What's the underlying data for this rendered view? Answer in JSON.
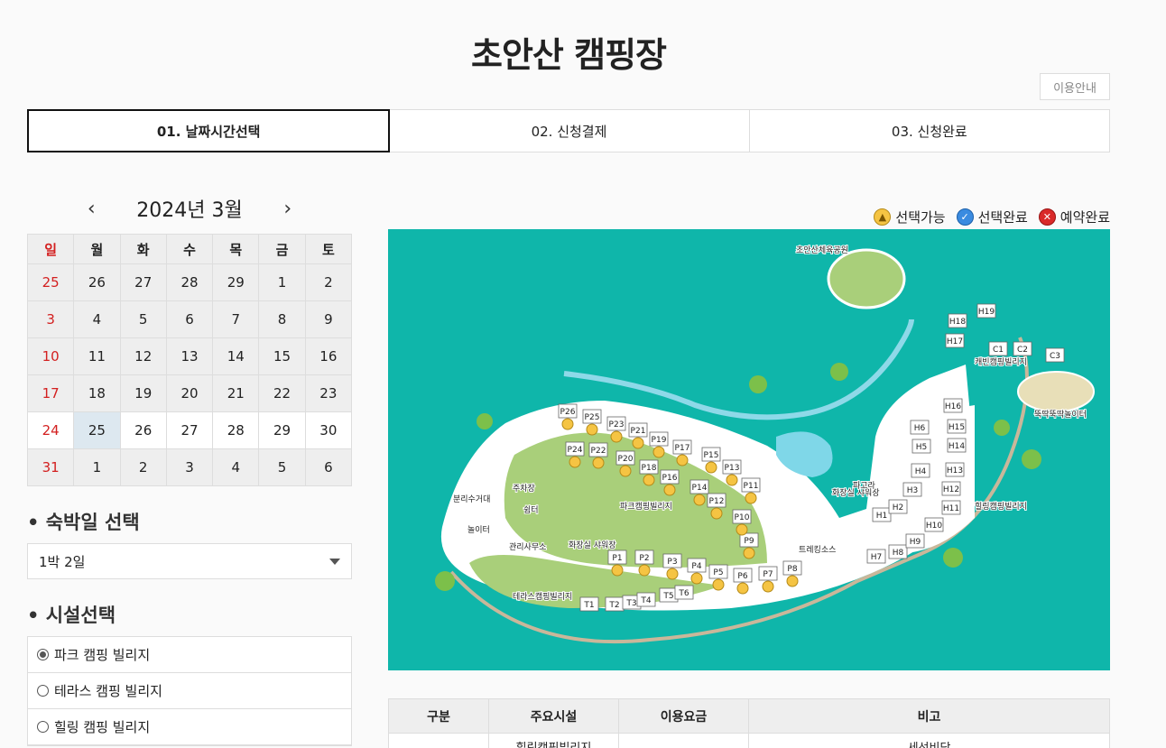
{
  "page": {
    "title": "초안산 캠핑장",
    "guide_button": "이용안내"
  },
  "steps": [
    {
      "label": "01. 날짜시간선택",
      "active": true
    },
    {
      "label": "02. 신청결제",
      "active": false
    },
    {
      "label": "03. 신청완료",
      "active": false
    }
  ],
  "calendar": {
    "month_label": "2024년 3월",
    "prev_icon": "chevron-left-icon",
    "next_icon": "chevron-right-icon",
    "weekdays": [
      "일",
      "월",
      "화",
      "수",
      "목",
      "금",
      "토"
    ],
    "weeks": [
      [
        "25",
        "26",
        "27",
        "28",
        "29",
        "1",
        "2"
      ],
      [
        "3",
        "4",
        "5",
        "6",
        "7",
        "8",
        "9"
      ],
      [
        "10",
        "11",
        "12",
        "13",
        "14",
        "15",
        "16"
      ],
      [
        "17",
        "18",
        "19",
        "20",
        "21",
        "22",
        "23"
      ],
      [
        "24",
        "25",
        "26",
        "27",
        "28",
        "29",
        "30"
      ],
      [
        "31",
        "1",
        "2",
        "3",
        "4",
        "5",
        "6"
      ]
    ],
    "selected_date": "25"
  },
  "stay": {
    "section_title": "숙박일 선택",
    "selected": "1박 2일"
  },
  "facility": {
    "section_title": "시설선택",
    "options": [
      "파크 캠핑 빌리지",
      "테라스 캠핑 빌리지",
      "힐링 캠핑 빌리지"
    ],
    "selected_index": 0
  },
  "legend": [
    {
      "label": "선택가능",
      "color": "#f5c443",
      "icon": "tent-available-icon"
    },
    {
      "label": "선택완료",
      "color": "#3a8be0",
      "icon": "check-selected-icon"
    },
    {
      "label": "예약완료",
      "color": "#d92a2a",
      "icon": "x-reserved-icon"
    }
  ],
  "map": {
    "labels": {
      "park_sports": "초안산체육공원",
      "cabin": "캐빈캠핑빌리지",
      "play": "뚝딱뚝딱놀이터",
      "park_village": "파크캠핑빌리지",
      "healing_village": "힐링캠핑빌리지",
      "terrace_village": "테라스캠핑빌리지",
      "management": "관리사무소",
      "toilet_shower": "화장실 샤워장",
      "trash": "분리수거대",
      "parking": "주차장",
      "shower2": "화장실 샤워장",
      "shelter": "쉼터",
      "resting": "파고라",
      "trail": "트레킹소스",
      "playground": "놀이터"
    },
    "park_sites": [
      "P1",
      "P2",
      "P3",
      "P4",
      "P5",
      "P6",
      "P7",
      "P8",
      "P9",
      "P10",
      "P11",
      "P12",
      "P13",
      "P14",
      "P15",
      "P16",
      "P17",
      "P18",
      "P19",
      "P20",
      "P21",
      "P22",
      "P23",
      "P24",
      "P25",
      "P26"
    ],
    "healing_sites": [
      "H1",
      "H2",
      "H3",
      "H4",
      "H5",
      "H6",
      "H7",
      "H8",
      "H9",
      "H10",
      "H11",
      "H12",
      "H13",
      "H14",
      "H15",
      "H16",
      "H17",
      "H18",
      "H19"
    ],
    "terrace_sites": [
      "T1",
      "T2",
      "T3",
      "T4",
      "T5",
      "T6"
    ],
    "cabin_sites": [
      "C1",
      "C2",
      "C3"
    ]
  },
  "info_table": {
    "headers": [
      "구분",
      "주요시설",
      "이용요금",
      "비고"
    ],
    "partial_row": [
      "",
      "힐링캠핑빌리지",
      "",
      "세선비닥"
    ]
  }
}
